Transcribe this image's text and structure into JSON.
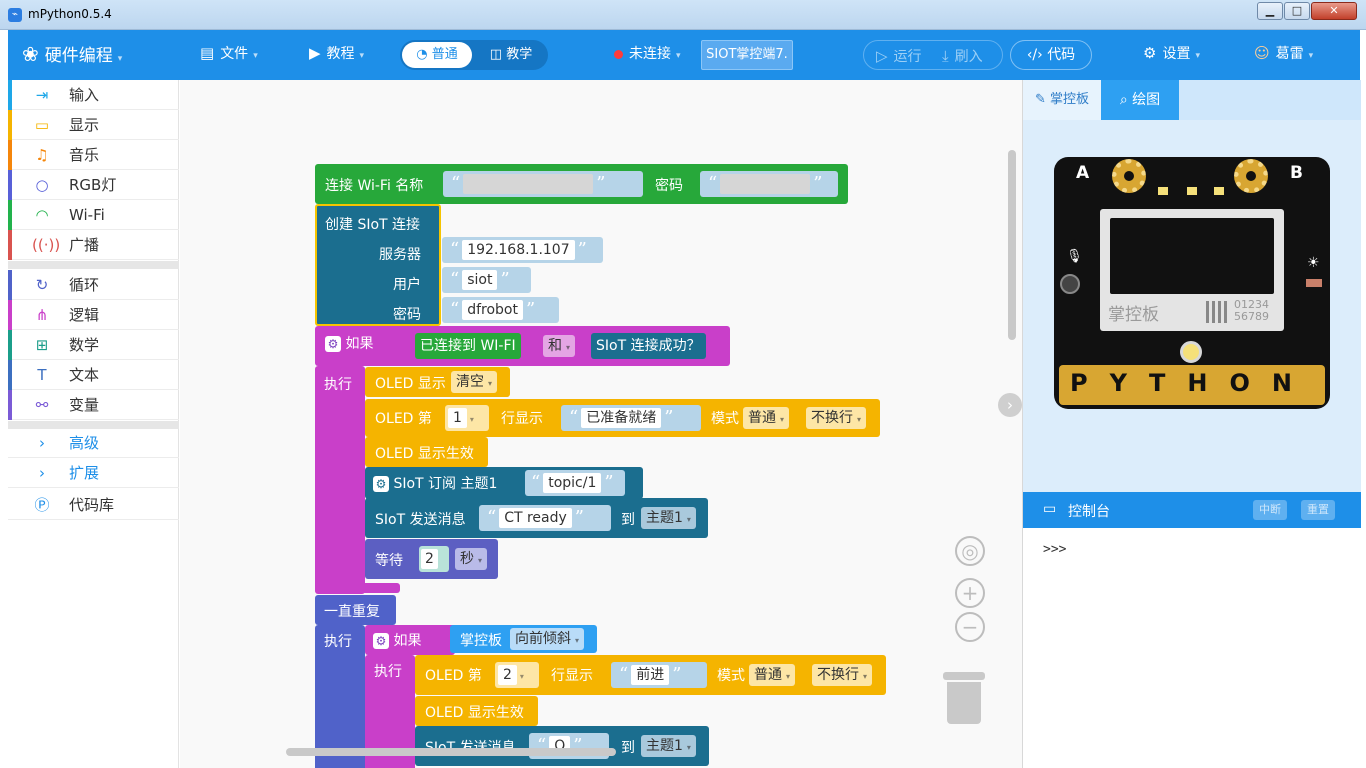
{
  "window": {
    "title": "mPython0.5.4",
    "minimize": "▁",
    "maximize": "□",
    "close": "✕"
  },
  "topbar": {
    "brand": "硬件编程",
    "file": "文件",
    "tutorial": "教程",
    "mode_normal": "普通",
    "mode_teach": "教学",
    "connection": "未连接",
    "device_tag": "SIOT掌控端7.",
    "run": "运行",
    "flash": "刷入",
    "code": "代码",
    "settings": "设置",
    "user": "葛雷"
  },
  "colors": {
    "primary": "#1e8fe8",
    "disconnected": "#ff3b3b"
  },
  "sidebar": {
    "items": [
      {
        "label": "输入",
        "icon": "input-icon",
        "color": "#1ea7e8"
      },
      {
        "label": "显示",
        "icon": "display-icon",
        "color": "#f5b400"
      },
      {
        "label": "音乐",
        "icon": "music-icon",
        "color": "#f5860b"
      },
      {
        "label": "RGB灯",
        "icon": "bulb-icon",
        "color": "#5860d8"
      },
      {
        "label": "Wi-Fi",
        "icon": "wifi-icon",
        "color": "#22b24c"
      },
      {
        "label": "广播",
        "icon": "broadcast-icon",
        "color": "#d9534f"
      },
      {
        "label": "循环",
        "icon": "loop-icon",
        "color": "#5062c9"
      },
      {
        "label": "逻辑",
        "icon": "logic-icon",
        "color": "#c93fc9"
      },
      {
        "label": "数学",
        "icon": "math-icon",
        "color": "#1b9e8a"
      },
      {
        "label": "文本",
        "icon": "text-icon",
        "color": "#3c6fc0"
      },
      {
        "label": "变量",
        "icon": "variable-icon",
        "color": "#7b5bd6"
      }
    ],
    "advanced": "高级",
    "extensions": "扩展",
    "library": "代码库"
  },
  "blocks": {
    "wifi_connect": "连接 Wi-Fi 名称",
    "wifi_password_label": "密码",
    "siot_create": "创建 SIoT 连接",
    "server_label": "服务器",
    "server": "192.168.1.107",
    "user_label": "用户",
    "user": "siot",
    "password_label": "密码",
    "password": "dfrobot",
    "if": "如果",
    "do": "执行",
    "wifi_connected": "已连接到 WI-FI",
    "and": "和",
    "siot_success": "SIoT 连接成功？",
    "oled_show": "OLED 显示",
    "clear": "清空",
    "oled_line": "OLED 第",
    "line1": "1",
    "line_show": "行显示",
    "ready_text": "已准备就绪",
    "mode_label": "模式",
    "mode_normal": "普通",
    "no_wrap": "不换行",
    "oled_apply": "OLED 显示生效",
    "subscribe": "SIoT 订阅 主题1",
    "topic": "topic/1",
    "send_msg": "SIoT 发送消息",
    "ct_ready": "CT ready",
    "to": "到",
    "topic1": "主题1",
    "wait": "等待",
    "wait_value": "2",
    "seconds": "秒",
    "forever": "一直重复",
    "board": "掌控板",
    "tilt_forward": "向前倾斜",
    "line2": "2",
    "forward": "前进",
    "msg_q": "Q"
  },
  "right_panel": {
    "tab_board": "掌控板",
    "tab_draw": "绘图",
    "pin_a": "A",
    "pin_b": "B",
    "board_brand": "掌控板",
    "board_code": "01234 56789",
    "board_logo": "PYTHON",
    "console_title": "控制台",
    "interrupt": "中断",
    "reset": "重置",
    "prompt": ">>>"
  }
}
